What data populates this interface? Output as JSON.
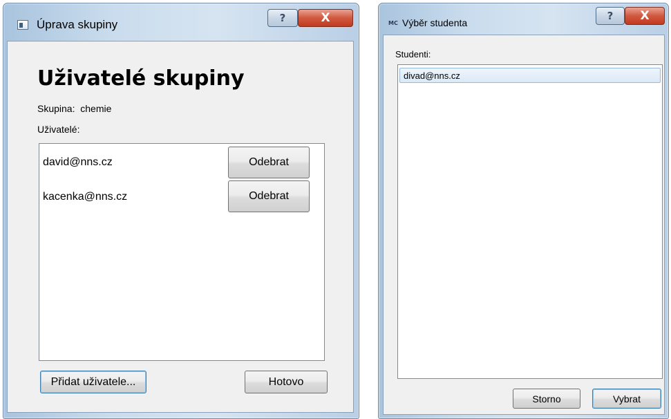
{
  "dialog_edit_group": {
    "title": "Úprava skupiny",
    "help_glyph": "?",
    "close_glyph": "X",
    "heading": "Uživatelé skupiny",
    "group_label": "Skupina:",
    "group_value": "chemie",
    "users_label": "Uživatelé:",
    "users": [
      {
        "email": "david@nns.cz",
        "remove_label": "Odebrat"
      },
      {
        "email": "kacenka@nns.cz",
        "remove_label": "Odebrat"
      }
    ],
    "add_user_label": "Přidat uživatele...",
    "done_label": "Hotovo"
  },
  "dialog_select_student": {
    "title": "Výběr studenta",
    "app_icon_text": "MC",
    "help_glyph": "?",
    "close_glyph": "X",
    "students_label": "Studenti:",
    "students": [
      "divad@nns.cz"
    ],
    "cancel_label": "Storno",
    "select_label": "Vybrat"
  }
}
